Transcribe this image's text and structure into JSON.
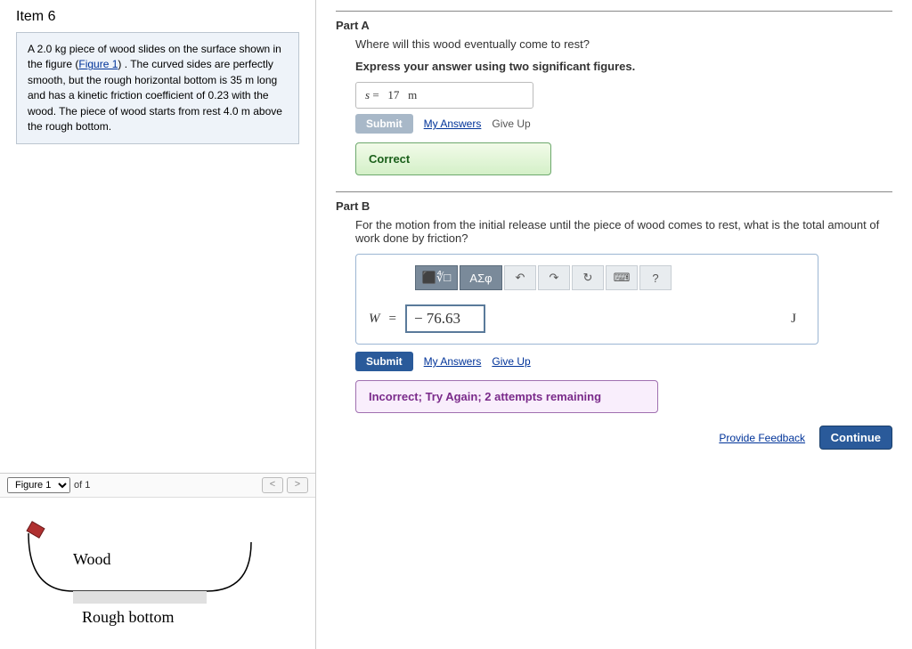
{
  "item_title": "Item 6",
  "problem": {
    "pre": "A 2.0 kg piece of wood slides on the surface shown in the figure (",
    "figLink": "Figure 1",
    "post": ") . The curved sides are perfectly smooth, but the rough horizontal bottom is 35 m long and has a kinetic friction coefficient of 0.23 with the wood. The piece of wood starts from rest 4.0 m above the rough bottom."
  },
  "figure": {
    "selector": "Figure 1",
    "of": "of 1",
    "labelWood": "Wood",
    "labelRough": "Rough bottom"
  },
  "partA": {
    "heading": "Part A",
    "question": "Where will this wood eventually come to rest?",
    "instruction": "Express your answer using two significant figures.",
    "answer_var": "s",
    "answer_eq": "=",
    "answer_val": "17",
    "answer_unit": "m",
    "submit": "Submit",
    "myAnswers": "My Answers",
    "giveUp": "Give Up",
    "feedback": "Correct"
  },
  "partB": {
    "heading": "Part B",
    "question": "For the motion from the initial release until the piece of wood comes to rest, what is the total amount of work done by friction?",
    "toolbar": {
      "template": "⬛∜□",
      "greek": "ΑΣφ",
      "undo": "↶",
      "redo": "↷",
      "reset": "↻",
      "keyboard": "⌨",
      "help": "?"
    },
    "eq_var": "W",
    "eq_sign": "=",
    "eq_value": "− 76.63",
    "eq_unit": "J",
    "submit": "Submit",
    "myAnswers": "My Answers",
    "giveUp": "Give Up",
    "feedback": "Incorrect; Try Again; 2 attempts remaining"
  },
  "footer": {
    "provide": "Provide Feedback",
    "continue": "Continue"
  }
}
